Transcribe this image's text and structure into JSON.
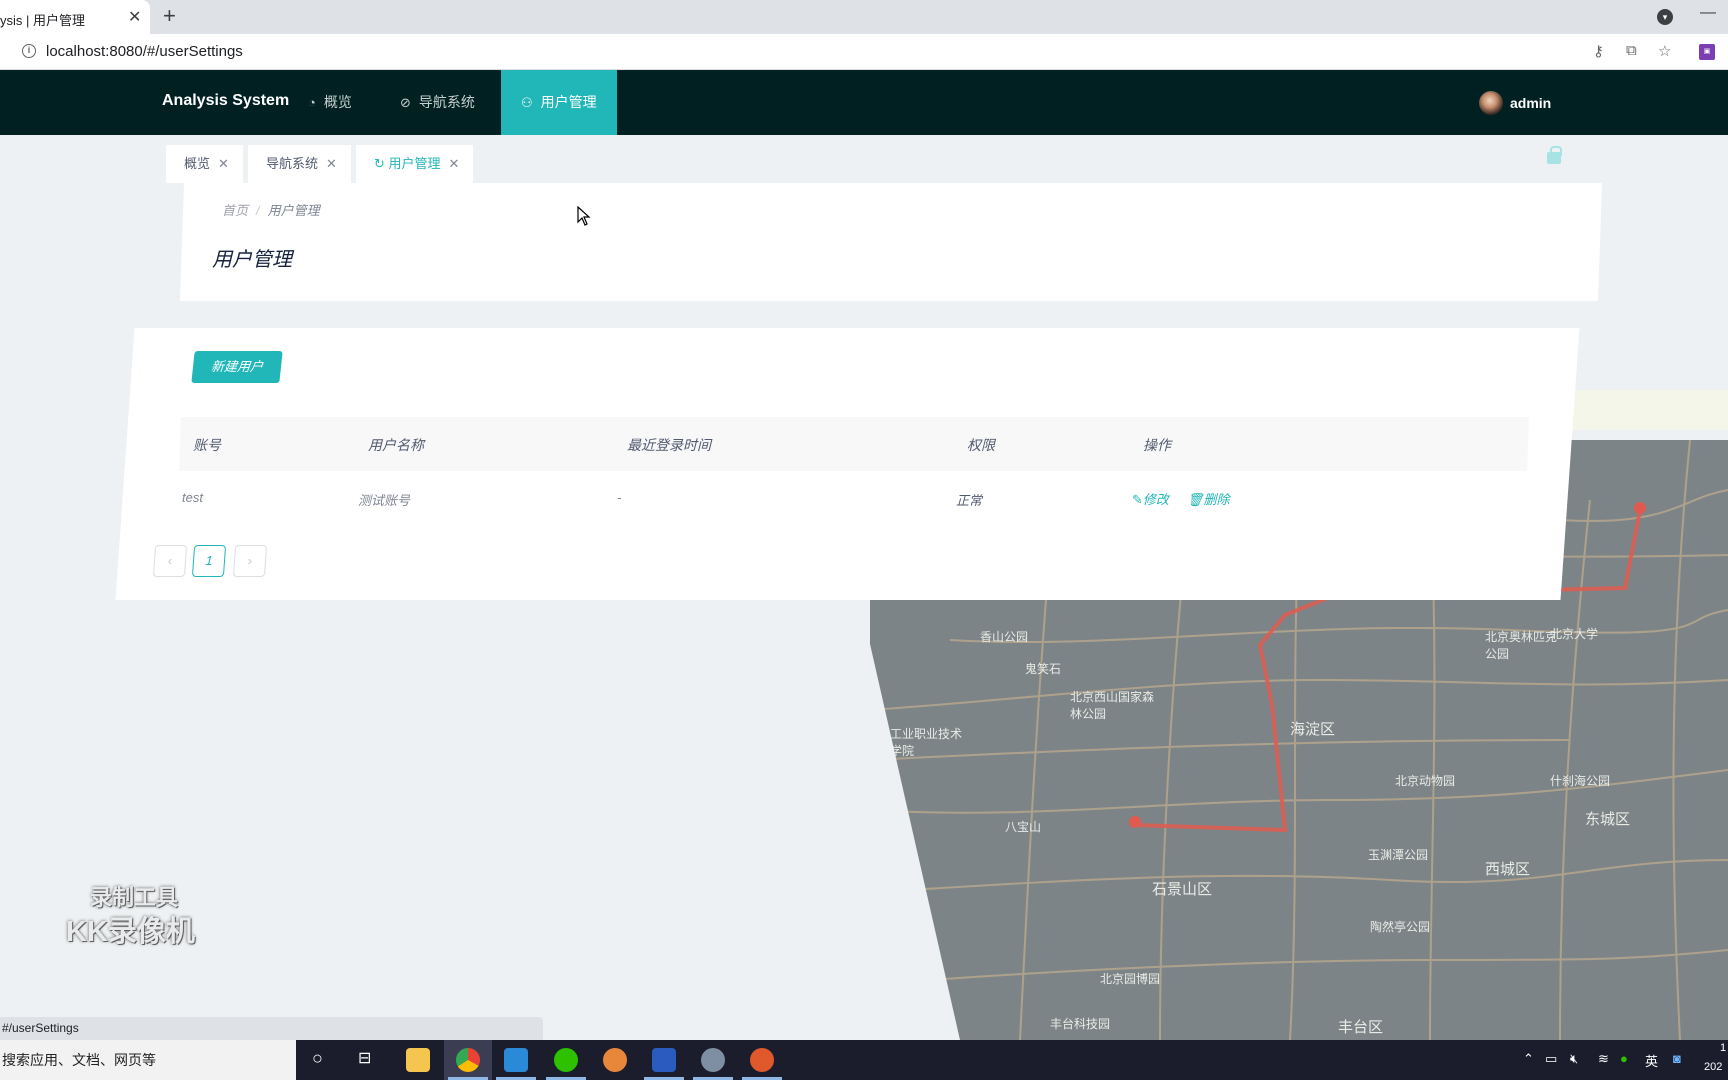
{
  "browser": {
    "tab_title": "ysis | 用户管理",
    "tab_close": "✕",
    "new_tab": "+",
    "url": "localhost:8080/#/userSettings",
    "status_url": "#/userSettings",
    "info_icon": "i"
  },
  "header": {
    "brand": "Analysis System",
    "nav": [
      {
        "label": "概览",
        "icon": "dashboard-icon"
      },
      {
        "label": "导航系统",
        "icon": "compass-icon"
      },
      {
        "label": "用户管理",
        "icon": "user-icon",
        "active": true
      }
    ],
    "user": "admin"
  },
  "page_tabs": [
    {
      "label": "概览"
    },
    {
      "label": "导航系统"
    },
    {
      "label": "用户管理",
      "active": true
    }
  ],
  "breadcrumb": {
    "home": "首页",
    "separator": "/",
    "current": "用户管理"
  },
  "page_title": "用户管理",
  "new_user_button": "新建用户",
  "table": {
    "columns": [
      "账号",
      "用户名称",
      "最近登录时间",
      "权限",
      "操作"
    ],
    "rows": [
      {
        "account": "test",
        "name": "测试账号",
        "last_login": "-",
        "permission": "正常",
        "edit": "修改",
        "delete": "删除"
      }
    ]
  },
  "pagination": {
    "prev": "‹",
    "current": "1",
    "next": "›"
  },
  "map_labels": [
    "海淀区",
    "东城区",
    "西城区",
    "石景山区",
    "丰台区",
    "北京西山国家森林公园",
    "北京奥林匹克公园",
    "香山公园",
    "鬼笑石",
    "北京动物园",
    "什刹海公园",
    "北京大学",
    "工业职业技术学院",
    "玉渊潭公园",
    "八宝山",
    "北京园博园",
    "陶然亭公园",
    "丰台科技园"
  ],
  "watermark": {
    "line1": "录制工具",
    "line2": "KK录像机"
  },
  "taskbar": {
    "search_placeholder": "搜索应用、文档、网页等",
    "ime": "英",
    "clock_a": "1",
    "clock_b": "202"
  },
  "colors": {
    "accent": "#21b6b8",
    "appbar": "#012021",
    "route": "#e05a4f"
  }
}
